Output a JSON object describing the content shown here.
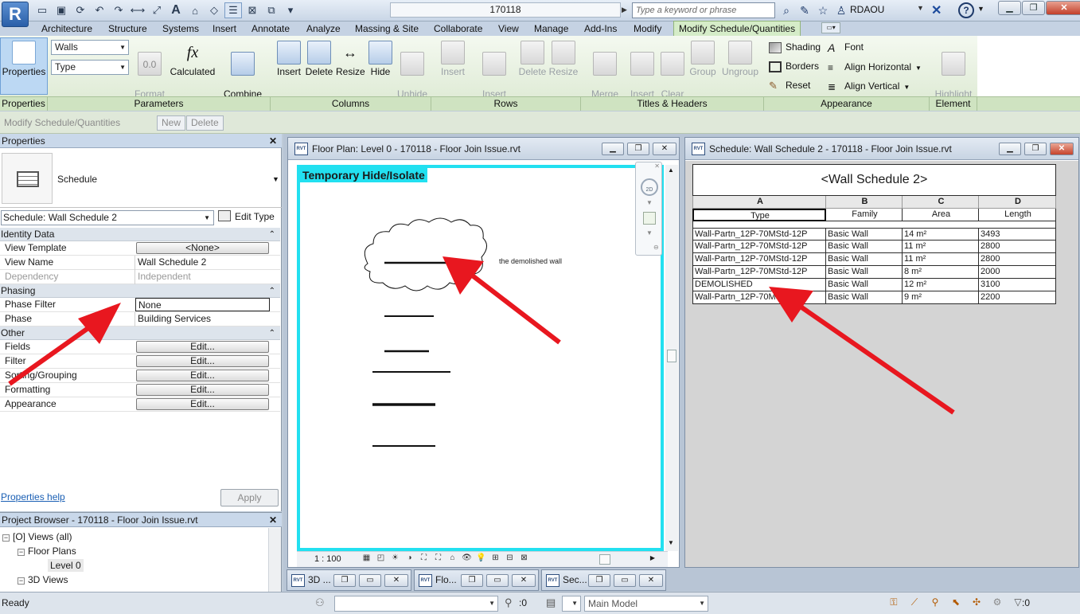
{
  "app": {
    "logo": "R",
    "document_title": "170118",
    "search_placeholder": "Type a keyword or phrase",
    "user": "RDAOU"
  },
  "ribbon_tabs": [
    "Architecture",
    "Structure",
    "Systems",
    "Insert",
    "Annotate",
    "Analyze",
    "Massing & Site",
    "Collaborate",
    "View",
    "Manage",
    "Add-Ins",
    "Modify",
    "Modify Schedule/Quantities"
  ],
  "ribbon": {
    "properties_label": "Properties",
    "params_combo1": "Walls",
    "params_combo2": "Type",
    "format_unit_label": "Format\nUnit",
    "format_unit_value": "0.0",
    "calculated_label": "Calculated",
    "combine_label": "Combine\nParameters",
    "insert_label": "Insert",
    "delete_label": "Delete",
    "resize_label": "Resize",
    "hide_label": "Hide",
    "unhide_label": "Unhide\nAll",
    "rows_insert": "Insert",
    "rows_insert_data_row": "Insert\nData Row",
    "rows_delete": "Delete",
    "rows_resize": "Resize",
    "merge_label": "Merge\nUnmerge",
    "insert_image_label": "Insert\nImage",
    "clear_cell_label": "Clear\nCell",
    "group_label": "Group",
    "ungroup_label": "Ungroup",
    "shading_label": "Shading",
    "borders_label": "Borders",
    "reset_label": "Reset",
    "font_label": "Font",
    "align_h_label": "Align  Horizontal",
    "align_v_label": "Align  Vertical",
    "highlight_label": "Highlight\nin Model",
    "panels": [
      "Properties",
      "Parameters",
      "Columns",
      "Rows",
      "Titles & Headers",
      "Appearance",
      "Element"
    ]
  },
  "optbar": {
    "context": "Modify Schedule/Quantities",
    "new": "New",
    "delete": "Delete"
  },
  "properties": {
    "title": "Properties",
    "type_name": "Schedule",
    "instance": "Schedule: Wall Schedule 2",
    "edit_type": "Edit Type",
    "groups": [
      {
        "name": "Identity Data",
        "rows": [
          {
            "name": "View Template",
            "value": "<None>",
            "kind": "button"
          },
          {
            "name": "View Name",
            "value": "Wall Schedule 2",
            "kind": "text"
          },
          {
            "name": "Dependency",
            "value": "Independent",
            "kind": "disabled"
          }
        ]
      },
      {
        "name": "Phasing",
        "rows": [
          {
            "name": "Phase Filter",
            "value": "None",
            "kind": "boxed"
          },
          {
            "name": "Phase",
            "value": "Building Services",
            "kind": "text"
          }
        ]
      },
      {
        "name": "Other",
        "rows": [
          {
            "name": "Fields",
            "value": "Edit...",
            "kind": "button"
          },
          {
            "name": "Filter",
            "value": "Edit...",
            "kind": "button"
          },
          {
            "name": "Sorting/Grouping",
            "value": "Edit...",
            "kind": "button"
          },
          {
            "name": "Formatting",
            "value": "Edit...",
            "kind": "button"
          },
          {
            "name": "Appearance",
            "value": "Edit...",
            "kind": "button"
          }
        ]
      }
    ],
    "help": "Properties help",
    "apply": "Apply"
  },
  "browser": {
    "title": "Project Browser - 170118 - Floor Join Issue.rvt",
    "nodes": [
      "Views (all)",
      "Floor Plans",
      "Level 0",
      "3D Views"
    ]
  },
  "floor_plan": {
    "title": "Floor Plan: Level 0 - 170118 - Floor Join Issue.rvt",
    "temp_label": "Temporary Hide/Isolate",
    "annotation": "the demolished wall",
    "scale": "1 : 100"
  },
  "schedule": {
    "window_title": "Schedule: Wall Schedule 2 - 170118 - Floor Join Issue.rvt",
    "title": "<Wall Schedule 2>",
    "letters": [
      "A",
      "B",
      "C",
      "D"
    ],
    "headers": [
      "Type",
      "Family",
      "Area",
      "Length"
    ],
    "rows": [
      [
        "Wall-Partn_12P-70MStd-12P",
        "Basic Wall",
        "14 m²",
        "3493"
      ],
      [
        "Wall-Partn_12P-70MStd-12P",
        "Basic Wall",
        "11 m²",
        "2800"
      ],
      [
        "Wall-Partn_12P-70MStd-12P",
        "Basic Wall",
        "11 m²",
        "2800"
      ],
      [
        "Wall-Partn_12P-70MStd-12P",
        "Basic Wall",
        "8 m²",
        "2000"
      ],
      [
        "DEMOLISHED",
        "Basic Wall",
        "12 m²",
        "3100"
      ],
      [
        "Wall-Partn_12P-70MStd-12P",
        "Basic Wall",
        "9 m²",
        "2200"
      ]
    ]
  },
  "minimized": [
    "3D ...",
    "Flo...",
    "Sec..."
  ],
  "status": {
    "ready": "Ready",
    "worksets": ":0",
    "model": "Main Model",
    "filter_count": ":0"
  },
  "colors": {
    "accent_tab": "#d5ecc8",
    "isolate_border": "#22e0f0",
    "annotation_arrow": "#e8171f"
  }
}
